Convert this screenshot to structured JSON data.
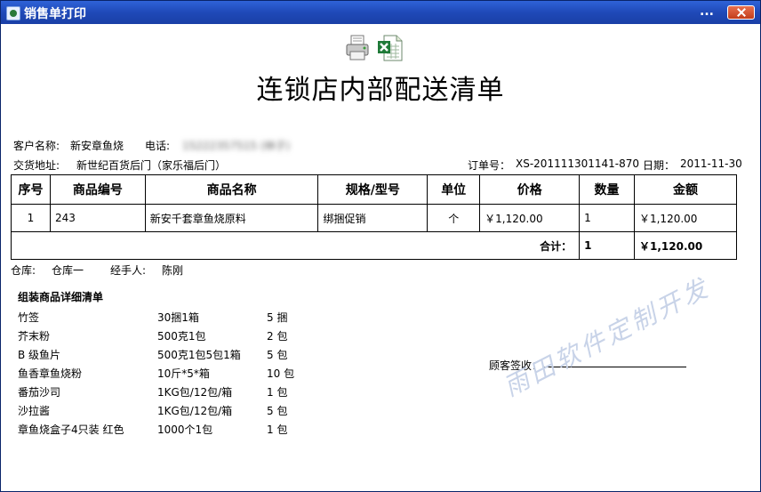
{
  "window": {
    "title": "销售单打印",
    "menu_dots": "..."
  },
  "icons": {
    "print": "printer-icon",
    "export": "excel-icon"
  },
  "document": {
    "title": "连锁店内部配送清单",
    "customer_label": "客户名称:",
    "customer_value": "新安章鱼烧",
    "phone_label": "电话:",
    "phone_value": "15222357515 (林子)",
    "address_label": "交货地址:",
    "address_value": "新世纪百货后门（家乐福后门）",
    "order_label": "订单号：",
    "order_value": "XS-201111301141-870",
    "date_label": "日期：",
    "date_value": "2011-11-30"
  },
  "table": {
    "headers": [
      "序号",
      "商品编号",
      "商品名称",
      "规格/型号",
      "单位",
      "价格",
      "数量",
      "金额"
    ],
    "rows": [
      [
        "1",
        "243",
        "新安千套章鱼烧原料",
        "绑捆促销",
        "个",
        "￥1,120.00",
        "1",
        "￥1,120.00"
      ]
    ],
    "total_label": "合计：",
    "total_qty": "1",
    "total_amount": "￥1,120.00"
  },
  "footer": {
    "warehouse_label": "仓库:",
    "warehouse_value": "仓库一",
    "handler_label": "经手人:",
    "handler_value": "陈刚"
  },
  "assembly": {
    "title": "组装商品详细清单",
    "items": [
      [
        "竹签",
        "30捆1箱",
        "5 捆"
      ],
      [
        "芥末粉",
        "500克1包",
        "2 包"
      ],
      [
        "B 级鱼片",
        "500克1包5包1箱",
        "5 包"
      ],
      [
        "鱼香章鱼烧粉",
        "10斤*5*箱",
        "10 包"
      ],
      [
        "番茄沙司",
        "1KG包/12包/箱",
        "1 包"
      ],
      [
        "沙拉酱",
        "1KG包/12包/箱",
        "5 包"
      ],
      [
        "章鱼烧盒子4只装 红色",
        "1000个1包",
        "1 包"
      ]
    ]
  },
  "signature": {
    "label": "顾客签收："
  },
  "watermark": "雨田软件定制开发",
  "colors": {
    "titlebar": "#1f49b8",
    "close": "#c23d1b",
    "watermark": "#c8d3e8"
  }
}
